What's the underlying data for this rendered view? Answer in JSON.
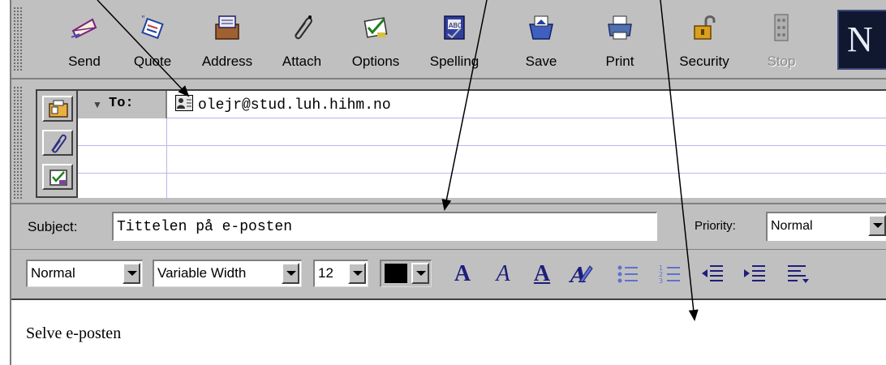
{
  "toolbar": {
    "buttons": [
      {
        "label": "Send",
        "icon": "send-icon",
        "enabled": true
      },
      {
        "label": "Quote",
        "icon": "quote-icon",
        "enabled": true
      },
      {
        "label": "Address",
        "icon": "address-book-icon",
        "enabled": true
      },
      {
        "label": "Attach",
        "icon": "paperclip-icon",
        "enabled": true
      },
      {
        "label": "Options",
        "icon": "options-checklist-icon",
        "enabled": true
      },
      {
        "label": "Spelling",
        "icon": "spellcheck-icon",
        "enabled": true
      },
      {
        "label": "Save",
        "icon": "save-icon",
        "enabled": true
      },
      {
        "label": "Print",
        "icon": "printer-icon",
        "enabled": true
      },
      {
        "label": "Security",
        "icon": "padlock-icon",
        "enabled": true
      },
      {
        "label": "Stop",
        "icon": "stop-icon",
        "enabled": false
      }
    ],
    "logo_letter": "N"
  },
  "address": {
    "type_label": "To:",
    "recipient": "olejr@stud.luh.hihm.no"
  },
  "subject": {
    "label": "Subject:",
    "value": "Tittelen på e-posten"
  },
  "priority": {
    "label": "Priority:",
    "value": "Normal"
  },
  "format": {
    "paragraph_style": "Normal",
    "font": "Variable Width",
    "size": "12",
    "text_color": "#000000"
  },
  "body": {
    "text": "Selve e-posten"
  },
  "colors": {
    "chrome": "#c0c0c0",
    "format_icons": "#1e1e7a",
    "address_lines": "#b9b6f0"
  }
}
